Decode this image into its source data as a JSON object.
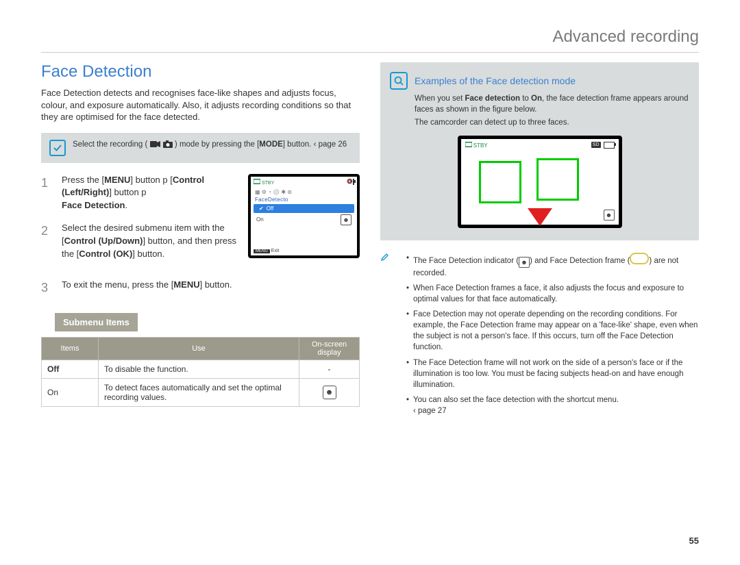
{
  "header": {
    "title": "Advanced recording"
  },
  "section": {
    "title": "Face Detection",
    "intro": "Face Detection detects and recognises face-like shapes and adjusts focus, colour, and exposure automatically. Also, it adjusts recording conditions so that they are optimised for the face detected."
  },
  "mode_note": {
    "pre": "Select the recording (",
    "post": ") mode by pressing the [",
    "button": "MODE",
    "tail": "] button. ",
    "pageref": "‹ page 26"
  },
  "steps": [
    {
      "line1_a": "Press the [",
      "line1_b": "MENU",
      "line1_c": "] button p",
      "line2_a": "[",
      "line2_b": "Control (Left/Right)",
      "line2_c": "] button  p ",
      "line3": "Face Detection",
      "line3_suffix": "."
    },
    {
      "line1": "Select the desired submenu item with the [",
      "b1": "Control (Up/Down)",
      "line2": "] button, and then press the [",
      "b2": "Control (OK)",
      "line3": "] button."
    },
    {
      "line1": "To exit the menu, press the [",
      "b1": "MENU",
      "line2": "] button."
    }
  ],
  "lcd_menu": {
    "toptext": "STBY",
    "title": "FaceDetecto",
    "opt_off": "Off",
    "opt_on": "On",
    "menu_label": "MENU",
    "exit": "Exit"
  },
  "submenu": {
    "header_label": "Submenu Items",
    "cols": {
      "items": "Items",
      "use": "Use",
      "display": "On-screen display"
    },
    "rows": [
      {
        "item": "Off",
        "use": "To disable the function.",
        "display": "-"
      },
      {
        "item": "On",
        "use": "To detect faces automatically and set the optimal recording values.",
        "display": "icon"
      }
    ]
  },
  "right": {
    "examples_title": "Examples of the Face detection mode",
    "p1_a": "When you set ",
    "p1_b": "Face detection",
    "p1_c": " to ",
    "p1_d": "On",
    "p1_e": ", the face detection frame appears around faces as shown in the figure below.",
    "p2": "The camcorder can detect up to three faces.",
    "lcd": {
      "stby": "STBY",
      "sd": "SD"
    }
  },
  "notes": {
    "n1_a": "The Face Detection indicator (",
    "n1_b": ") and Face Detection frame (",
    "n1_c": ") are not recorded.",
    "n2": "When Face Detection frames a face, it also adjusts the focus and exposure to optimal values for that face automatically.",
    "n3": "Face Detection may not operate depending on the recording conditions. For example, the Face Detection frame may appear on a 'face-like' shape, even when the subject is not a person's face. If this occurs, turn off the Face Detection function.",
    "n4": "The Face Detection frame will not work on the side of a person's face or if the illumination is too low. You must be facing subjects  head-on  and have enough illumination.",
    "n5": "You can also set the face detection with the shortcut menu.",
    "n5_ref": "‹ page 27"
  },
  "page_number": "55"
}
